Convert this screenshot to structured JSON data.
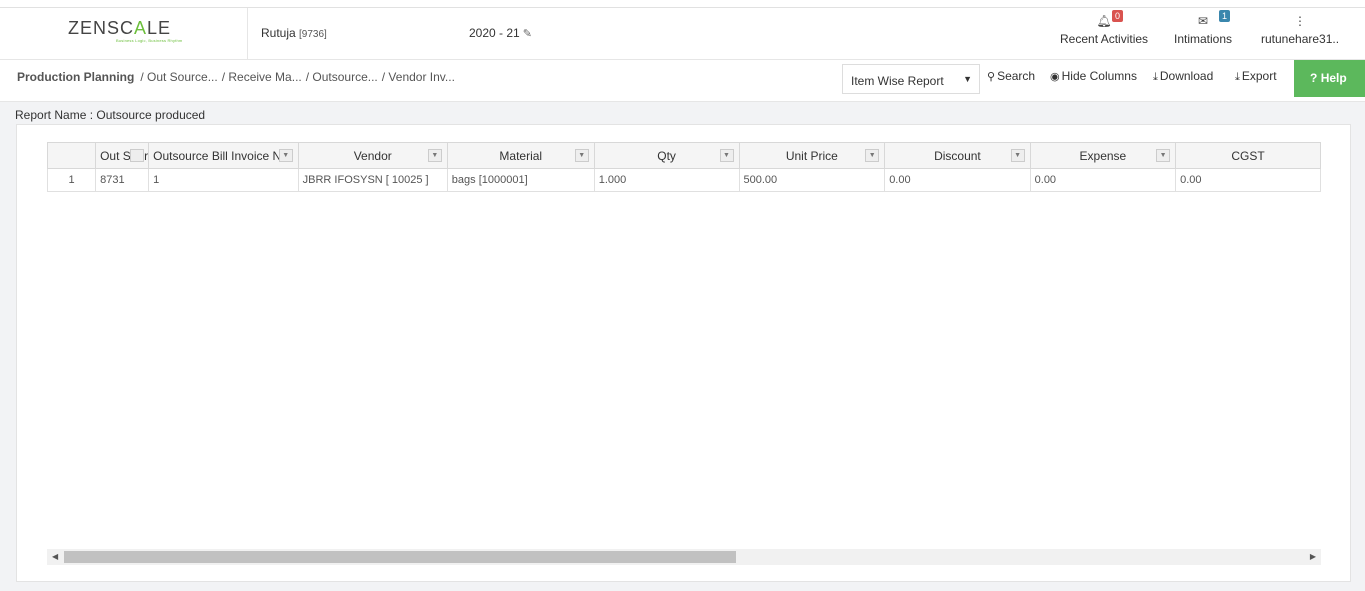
{
  "header": {
    "logo_text_a": "ZENSC",
    "logo_text_b": "A",
    "logo_text_c": "LE",
    "logo_tagline": "Business Logic, Business Rhythm",
    "company": "Rutuja",
    "company_code": "[9736]",
    "fiscal_year": "2020 - 21",
    "recent_activities": {
      "label": "Recent Activities",
      "count": "0"
    },
    "intimations": {
      "label": "Intimations",
      "count": "1"
    },
    "user": "rutunehare31.."
  },
  "toolbar": {
    "breadcrumb": [
      "Production Planning",
      "/ Out Source...",
      "/ Receive Ma...",
      "/ Outsource...",
      "/ Vendor Inv..."
    ],
    "report_select": "Item Wise Report",
    "search": "Search",
    "hide_columns": "Hide Columns",
    "download": "Download",
    "export": "Export",
    "help": "Help"
  },
  "report": {
    "name": "Report Name : Outsource produced"
  },
  "table": {
    "columns": [
      "Out Sour",
      "Outsource Bill Invoice No",
      "Vendor",
      "Material",
      "Qty",
      "Unit Price",
      "Discount",
      "Expense",
      "CGST"
    ],
    "rows": [
      [
        "1",
        "8731",
        "1",
        "JBRR IFOSYSN [ 10025 ]",
        "bags [1000001]",
        "1.000",
        "500.00",
        "0.00",
        "0.00",
        "0.00"
      ]
    ]
  },
  "colors": {
    "help_bg": "#5cb85c",
    "badge_red": "#d9534f",
    "badge_blue": "#3a87ad",
    "logo_green": "#6cbf3c"
  }
}
